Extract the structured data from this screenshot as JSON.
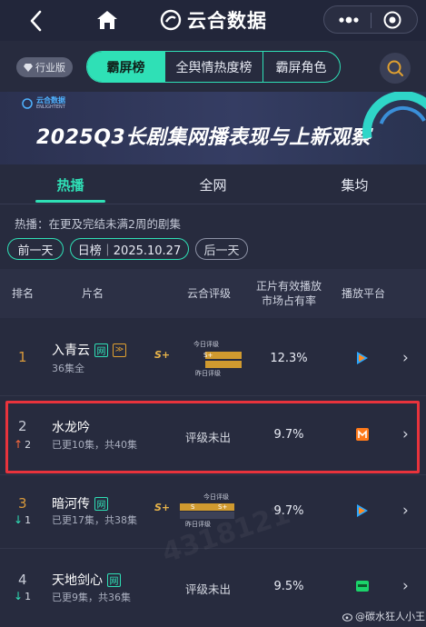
{
  "app": {
    "brand": "云合数据"
  },
  "filters": {
    "industry_label": "行业版",
    "segments": [
      {
        "label": "霸屏榜",
        "active": true
      },
      {
        "label": "全舆情热度榜",
        "active": false
      },
      {
        "label": "霸屏角色",
        "active": false
      }
    ]
  },
  "banner": {
    "logo_main": "云合数据",
    "logo_sub": "ENLIGHTENT",
    "title": "2025Q3长剧集网播表现与上新观察"
  },
  "tabs": [
    {
      "label": "热播",
      "active": true
    },
    {
      "label": "全网",
      "active": false
    },
    {
      "label": "集均",
      "active": false
    }
  ],
  "description": "热播：在更及完结未满2周的剧集",
  "date_nav": {
    "prev_label": "前一天",
    "current_label": "日榜｜2025.10.27",
    "next_label": "后一天"
  },
  "table": {
    "headers": {
      "rank": "排名",
      "title": "片名",
      "rating": "云合评级",
      "share": "正片有效播放\n市场占有率",
      "platform": "播放平台"
    },
    "rows": [
      {
        "rank": "1",
        "change": "",
        "title": "入青云",
        "badge_net": "网",
        "badge_extra": "≫",
        "sub": "36集全",
        "rating_today_label": "今日评级",
        "rating_yesterday_label": "昨日评级",
        "rating_today": "S+",
        "rating_prev": "S+",
        "share": "12.3%",
        "platform_icon": "tencent-video-icon"
      },
      {
        "rank": "2",
        "change": "2",
        "change_dir": "up",
        "title": "水龙吟",
        "sub": "已更10集，共40集",
        "rating_text": "评级未出",
        "share": "9.7%",
        "platform_icon": "mango-tv-icon"
      },
      {
        "rank": "3",
        "change": "1",
        "change_dir": "down",
        "title": "暗河传",
        "badge_net": "网",
        "sub": "已更17集，共38集",
        "rating_today_label": "今日评级",
        "rating_yesterday_label": "昨日评级",
        "rating_today": "S",
        "rating_prev": "S+",
        "rating_main": "S+",
        "share": "9.7%",
        "platform_icon": "tencent-video-icon"
      },
      {
        "rank": "4",
        "change": "1",
        "change_dir": "down",
        "title": "天地剑心",
        "badge_net": "网",
        "sub": "已更9集，共36集",
        "rating_text": "评级未出",
        "share": "9.5%",
        "platform_icon": "iqiyi-icon"
      }
    ]
  },
  "watermark": {
    "text": "4318121"
  },
  "footer": {
    "weibo_handle": "@碳水狂人小王"
  },
  "colors": {
    "accent": "#2fe0b6",
    "highlight": "#e8333c",
    "gold": "#d99a3b"
  }
}
